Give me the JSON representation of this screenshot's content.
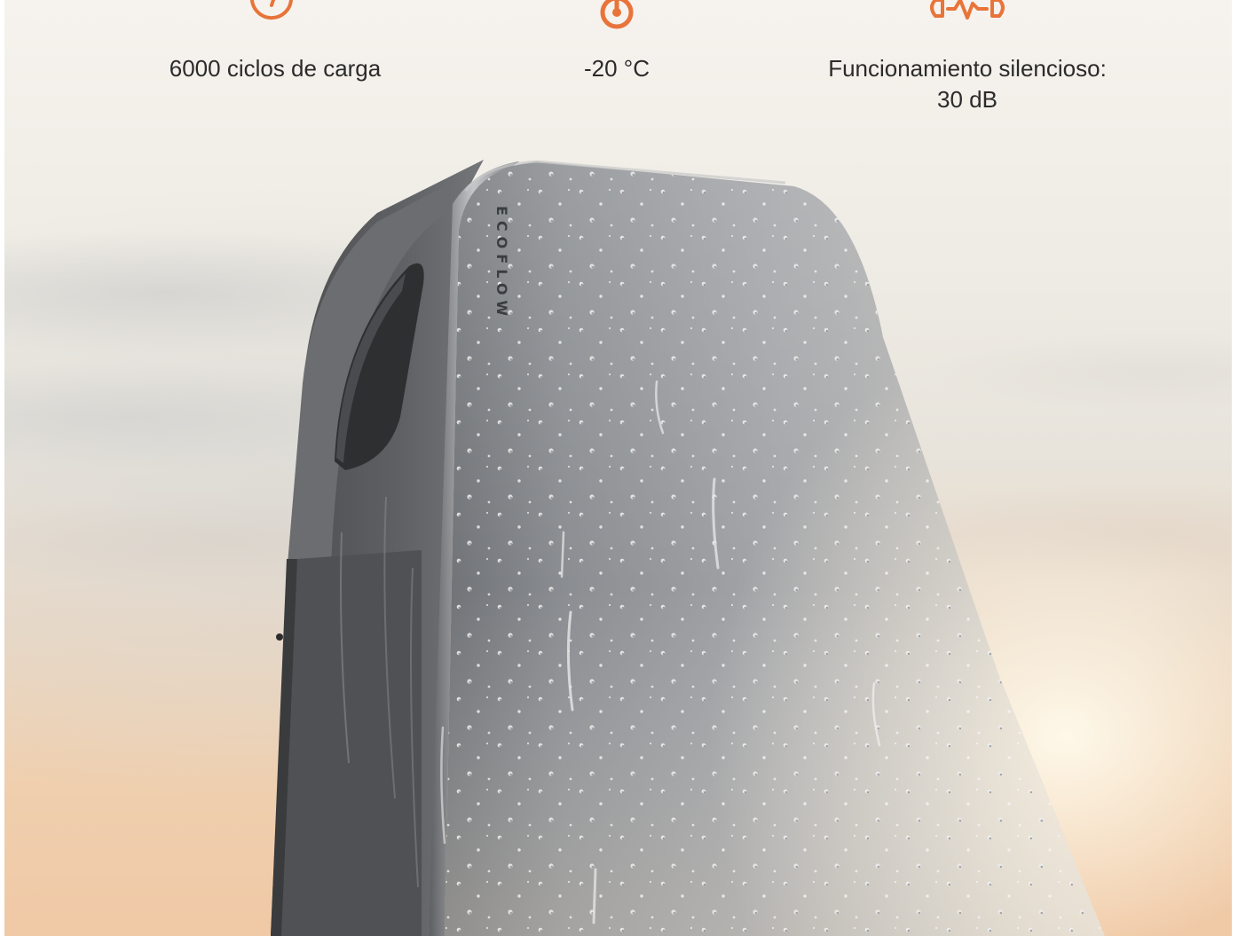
{
  "features": [
    {
      "icon": "charge-cycles-icon",
      "label": "6000 ciclos de carga"
    },
    {
      "icon": "temperature-icon",
      "label": "-20 °C"
    },
    {
      "icon": "sound-wave-icon",
      "label": "Funcionamiento silencioso:\n30 dB"
    }
  ],
  "brand": {
    "logo_text": "ECOFLOW"
  },
  "colors": {
    "accent": "#e8743a",
    "text": "#2b2b2b",
    "device": "#8e9093"
  }
}
